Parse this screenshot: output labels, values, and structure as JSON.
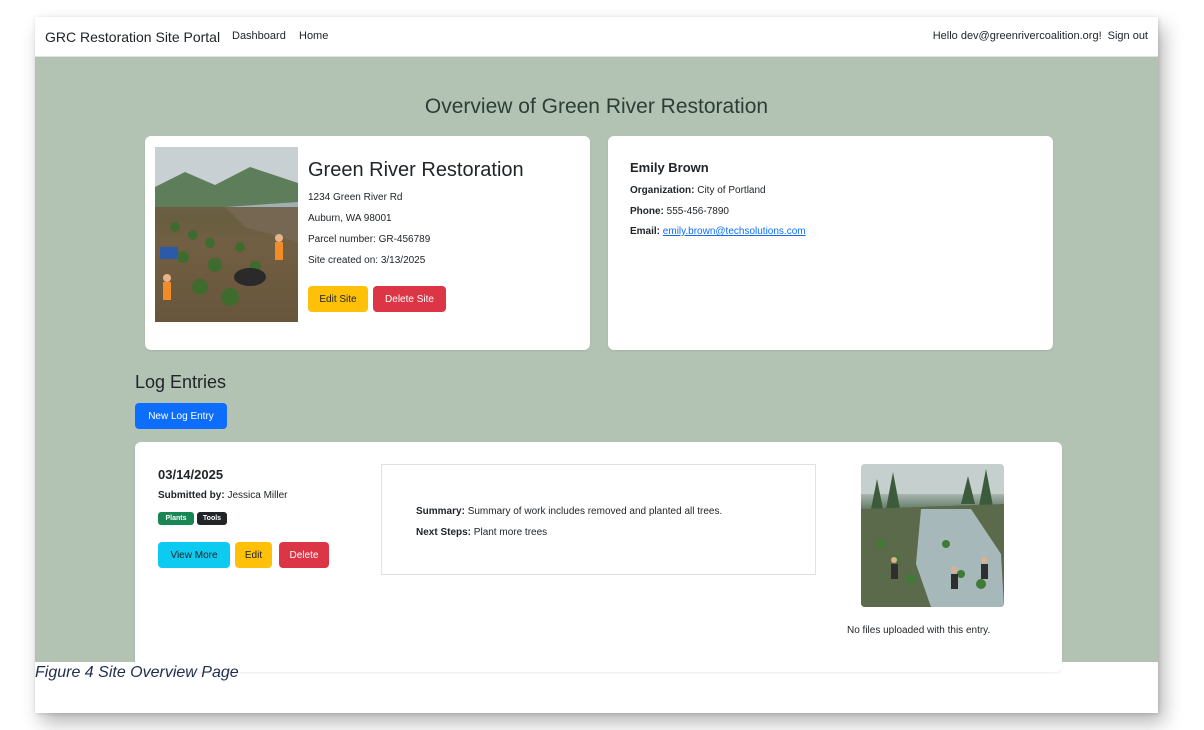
{
  "navbar": {
    "brand": "GRC Restoration Site Portal",
    "links": [
      "Dashboard",
      "Home"
    ],
    "greeting": "Hello dev@greenrivercoalition.org!",
    "sign_out": "Sign out"
  },
  "page": {
    "title": "Overview of Green River Restoration"
  },
  "site": {
    "name": "Green River Restoration",
    "address_line1": "1234 Green River Rd",
    "address_line2": "Auburn, WA 98001",
    "parcel": "Parcel number: GR-456789",
    "created": "Site created on: 3/13/2025",
    "edit_label": "Edit Site",
    "delete_label": "Delete Site"
  },
  "contact": {
    "name": "Emily Brown",
    "organization_label": "Organization:",
    "organization": "City of Portland",
    "phone_label": "Phone:",
    "phone": "555-456-7890",
    "email_label": "Email:",
    "email": "emily.brown@techsolutions.com"
  },
  "log": {
    "section_title": "Log Entries",
    "new_entry_label": "New Log Entry",
    "entries": [
      {
        "date": "03/14/2025",
        "submitted_label": "Submitted by:",
        "submitted_by": "Jessica Miller",
        "tags": [
          "Plants",
          "Tools"
        ],
        "view_more_label": "View More",
        "edit_label": "Edit",
        "delete_label": "Delete",
        "summary_label": "Summary:",
        "summary": "Summary of work includes removed and planted all trees.",
        "next_steps_label": "Next Steps:",
        "next_steps": "Plant more trees",
        "files_note": "No files uploaded with this entry."
      }
    ]
  },
  "caption": "Figure 4 Site Overview Page",
  "colors": {
    "page_background": "#b2c3b3",
    "warning": "#ffc107",
    "danger": "#dc3545",
    "info": "#0dcaf0",
    "primary": "#0d6efd",
    "tag_plants": "#198754",
    "tag_tools": "#212529"
  }
}
